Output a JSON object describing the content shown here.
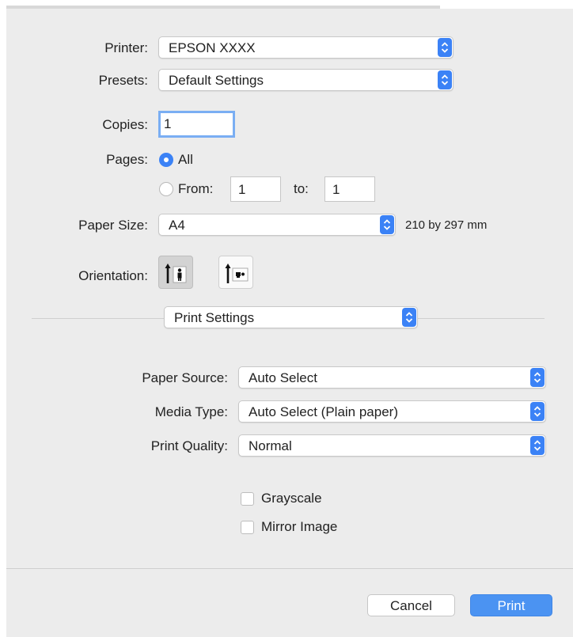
{
  "printer": {
    "label": "Printer:",
    "value": "EPSON XXXX"
  },
  "presets": {
    "label": "Presets:",
    "value": "Default Settings"
  },
  "copies": {
    "label": "Copies:",
    "value": "1"
  },
  "pages": {
    "label": "Pages:",
    "all_label": "All",
    "from_label": "From:",
    "from_value": "1",
    "to_label": "to:",
    "to_value": "1",
    "selected": "All"
  },
  "paper_size": {
    "label": "Paper Size:",
    "value": "A4",
    "dimensions": "210 by 297 mm"
  },
  "orientation": {
    "label": "Orientation:",
    "selected": "portrait"
  },
  "section_menu": {
    "value": "Print Settings"
  },
  "paper_source": {
    "label": "Paper Source:",
    "value": "Auto Select"
  },
  "media_type": {
    "label": "Media Type:",
    "value": "Auto Select (Plain paper)"
  },
  "print_quality": {
    "label": "Print Quality:",
    "value": "Normal"
  },
  "grayscale": {
    "label": "Grayscale",
    "checked": false
  },
  "mirror_image": {
    "label": "Mirror Image",
    "checked": false
  },
  "buttons": {
    "cancel": "Cancel",
    "print": "Print"
  },
  "colors": {
    "accent": "#3b82f6",
    "print_button": "#4b93f2",
    "dialog_bg": "#ececec"
  }
}
